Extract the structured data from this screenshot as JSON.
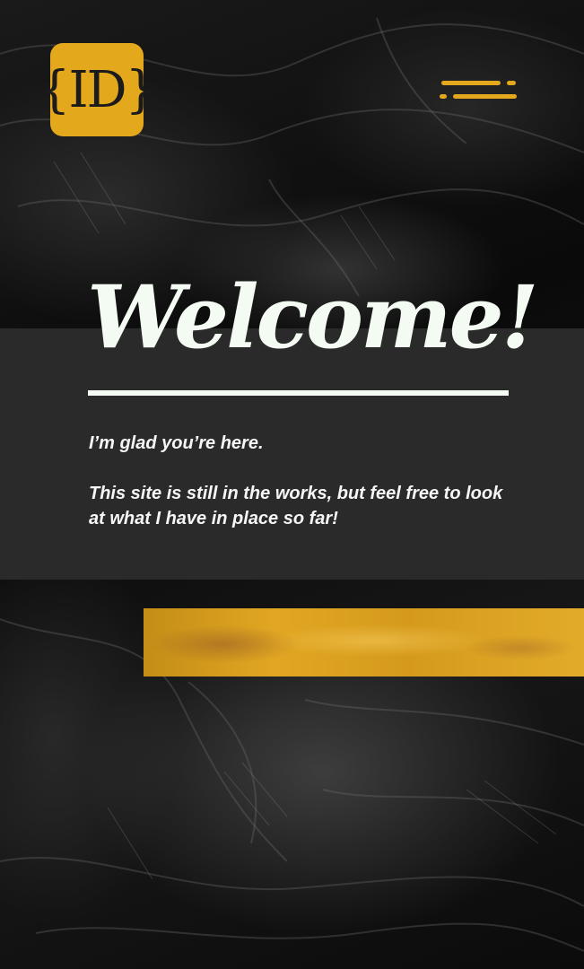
{
  "brand": {
    "logo_text": "{ID}",
    "accent_color": "#e4a81d"
  },
  "header": {
    "menu_icon": "hamburger-menu-icon"
  },
  "welcome": {
    "title": "Welcome!",
    "lines": [
      "I’m glad you’re here.",
      "This site is still in the works, but feel free to look at what I have in place so far!"
    ]
  },
  "colors": {
    "band": "#2a2a2a",
    "text": "#f3fbf3",
    "stripe": "#e1a622"
  }
}
